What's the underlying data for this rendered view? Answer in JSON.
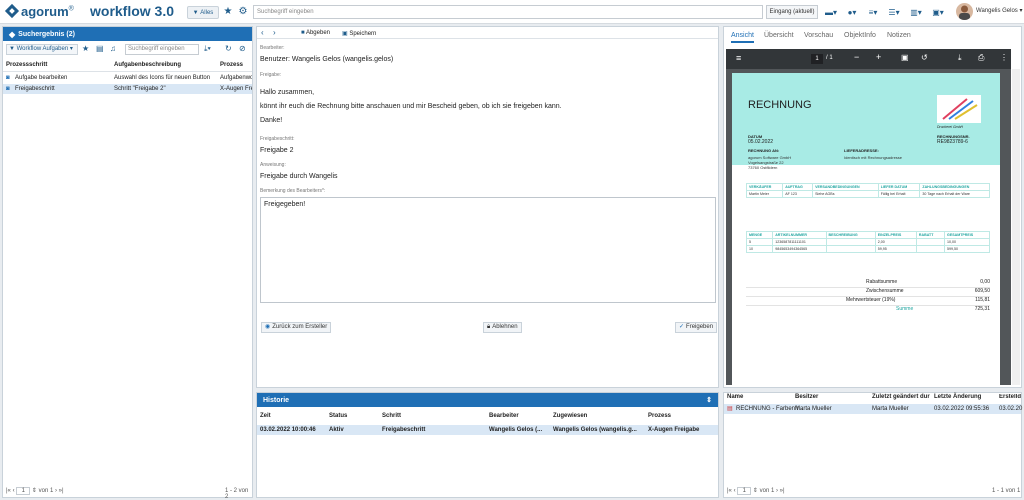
{
  "app": {
    "logo": "agorum",
    "logo_sup": "®",
    "title": "workflow 3.0"
  },
  "topbar": {
    "filter_label": "Alles",
    "search_placeholder": "Suchbegriff eingeben",
    "inbox_label": "Eingang (aktuell)",
    "user_name": "Wangelis Gelos"
  },
  "left": {
    "header": "Suchergebnis (2)",
    "filter_label": "Workflow Aufgaben",
    "search_placeholder": "Suchbegriff eingeben",
    "columns": [
      "Prozessschritt",
      "Aufgabenbeschreibung",
      "Prozess"
    ],
    "rows": [
      {
        "step": "Aufgabe bearbeiten",
        "desc": "Auswahl des Icons für neuen Button",
        "proc": "Aufgabenwo"
      },
      {
        "step": "Freigabeschritt",
        "desc": "Schritt \"Freigabe 2\"",
        "proc": "X-Augen Frei"
      }
    ],
    "pager": {
      "page": "1",
      "of": "von 1",
      "count": "1 - 2 von 2"
    }
  },
  "middle": {
    "toolbar": {
      "abgeben": "Abgeben",
      "speichern": "Speichern"
    },
    "bearbeiter_label": "Bearbeiter:",
    "bearbeiter_value": "Benutzer: Wangelis Gelos (wangelis.gelos)",
    "freigabe_label": "Freigabe:",
    "message_lines": [
      "Hallo zusammen,",
      "könnt ihr euch die Rechnung bitte anschauen und mir Bescheid geben, ob ich sie freigeben kann.",
      "Danke!"
    ],
    "step_label": "Freigabeschritt:",
    "step_value": "Freigabe 2",
    "hint_label": "Anweisung:",
    "hint_value": "Freigabe durch Wangelis",
    "comment_label": "Bemerkung des Bearbeiters*:",
    "comment_value": "Freigegeben!",
    "btn_back": "Zurück zum Ersteller",
    "btn_reject": "Ablehnen",
    "btn_approve": "Freigeben"
  },
  "history": {
    "header": "Historie",
    "columns": [
      "Zeit",
      "Status",
      "Schritt",
      "Bearbeiter",
      "Zugewiesen",
      "Prozess"
    ],
    "row": [
      "03.02.2022 10:00:46",
      "Aktiv",
      "Freigabeschritt",
      "Wangelis Gelos (...",
      "Wangelis Gelos (wangelis.g...",
      "X-Augen Freigabe"
    ]
  },
  "right": {
    "tabs": [
      "Ansicht",
      "Übersicht",
      "Vorschau",
      "ObjektInfo",
      "Notizen"
    ],
    "pdf_page": "1",
    "pdf_total": "/ 1",
    "invoice": {
      "title": "RECHNUNG",
      "brand": "Druckerei GmbH",
      "datum_label": "DATUM",
      "datum": "05.02.2022",
      "rnr_label": "RECHNUNGSNR.",
      "rnr": "RE9823789-6",
      "an_label": "RECHNUNG AN:",
      "an_lines": [
        "agorum Software GmbH",
        "Vogelsangstraße 22",
        "73760 Ostfildern"
      ],
      "liefer_label": "LIEFERADRESSE:",
      "liefer_line": "Identisch mit Rechnungsadresse",
      "t1_heads": [
        "VERKÄUFER",
        "AUFTRAG",
        "VERSANDBEDINGUNGEN",
        "LIEFER DATUM",
        "ZAHLUNGSBEDINGUNGEN"
      ],
      "t1_row": [
        "Martin Meier",
        "AF 123",
        "Siehe AGBs",
        "Fällig bei Erhalt",
        "30 Tage nach Erhalt der Ware"
      ],
      "t2_heads": [
        "MENGE",
        "ARTIKELNUMMER",
        "BESCHREIBUNG",
        "EINZELPREIS",
        "RABATT",
        "GESAMTPREIS"
      ],
      "t2_rows": [
        [
          "5",
          "1236587811111101",
          "",
          "2,00",
          "",
          "10,00"
        ],
        [
          "10",
          "9845653494364565",
          "",
          "59,95",
          "",
          "599,50"
        ]
      ],
      "sums": [
        [
          "Rabattsumme",
          "0,00"
        ],
        [
          "Zwischensumme",
          "609,50"
        ],
        [
          "Mehrwertsteuer (19%)",
          "115,81"
        ],
        [
          "Summe",
          "725,31"
        ]
      ]
    }
  },
  "rightbottom": {
    "columns": [
      "Name",
      "Besitzer",
      "Zuletzt geändert dur",
      "Letzte Änderung",
      "Erstelld"
    ],
    "row": [
      "RECHNUNG - Farbenfr...",
      "Marta Mueller",
      "Marta Mueller",
      "03.02.2022 09:55:36",
      "03.02.20"
    ],
    "pager": {
      "page": "1",
      "of": "von 1",
      "count": "1 - 1 von 1"
    }
  }
}
